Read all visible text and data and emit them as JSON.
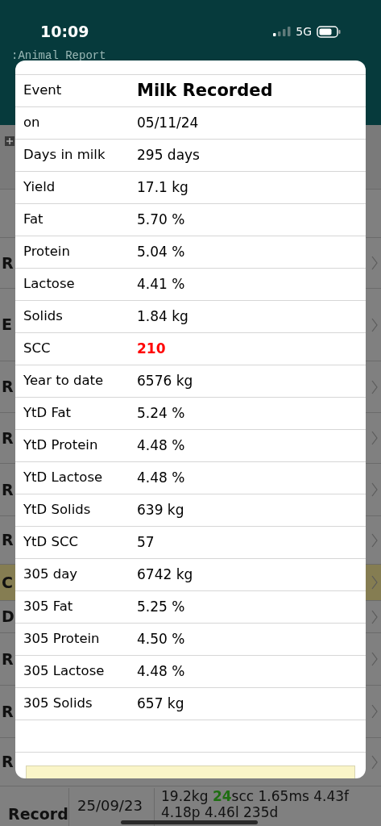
{
  "status_bar": {
    "time": "10:09",
    "network": "5G"
  },
  "header": {
    "title": ":Animal Report"
  },
  "list_rows": [
    {
      "label": "R",
      "highlighted": false
    },
    {
      "label": "E",
      "highlighted": false
    },
    {
      "label": "R",
      "highlighted": false
    },
    {
      "label": "R",
      "highlighted": false
    },
    {
      "label": "R",
      "highlighted": false
    },
    {
      "label": "R",
      "highlighted": false
    },
    {
      "label": "C",
      "highlighted": true
    },
    {
      "label": "D",
      "highlighted": false
    },
    {
      "label": "R",
      "highlighted": false
    },
    {
      "label": "R",
      "highlighted": false
    },
    {
      "label": "R",
      "highlighted": false
    }
  ],
  "last_row": {
    "label": "Record",
    "date": "25/09/23",
    "line_1": {
      "yield": "19.2kg ",
      "scc": "24",
      "rest": "scc 1.65ms 4.43f"
    },
    "line_2": "4.18p 4.46l 235d"
  },
  "popup": {
    "rows": [
      {
        "label": "Event",
        "value": "Milk Recorded",
        "kind": "title"
      },
      {
        "label": "on",
        "value": "05/11/24",
        "kind": "normal"
      },
      {
        "label": "Days in milk",
        "value": "295 days",
        "kind": "normal"
      },
      {
        "label": "Yield",
        "value": "17.1 kg",
        "kind": "normal"
      },
      {
        "label": "Fat",
        "value": "5.70 %",
        "kind": "normal"
      },
      {
        "label": "Protein",
        "value": "5.04 %",
        "kind": "normal"
      },
      {
        "label": "Lactose",
        "value": "4.41 %",
        "kind": "normal"
      },
      {
        "label": "Solids",
        "value": "1.84 kg",
        "kind": "normal"
      },
      {
        "label": "SCC",
        "value": "210",
        "kind": "alert"
      },
      {
        "label": "Year to date",
        "value": "6576 kg",
        "kind": "normal"
      },
      {
        "label": "YtD Fat",
        "value": "5.24 %",
        "kind": "normal"
      },
      {
        "label": "YtD Protein",
        "value": "4.48 %",
        "kind": "normal"
      },
      {
        "label": "YtD Lactose",
        "value": "4.48 %",
        "kind": "normal"
      },
      {
        "label": "YtD Solids",
        "value": "639 kg",
        "kind": "normal"
      },
      {
        "label": "YtD SCC",
        "value": "57",
        "kind": "normal"
      },
      {
        "label": "305 day",
        "value": "6742 kg",
        "kind": "normal"
      },
      {
        "label": "305 Fat",
        "value": "5.25 %",
        "kind": "normal"
      },
      {
        "label": "305 Protein",
        "value": "4.50 %",
        "kind": "normal"
      },
      {
        "label": "305 Lactose",
        "value": "4.48 %",
        "kind": "normal"
      },
      {
        "label": "305 Solids",
        "value": "657 kg",
        "kind": "normal"
      }
    ]
  }
}
